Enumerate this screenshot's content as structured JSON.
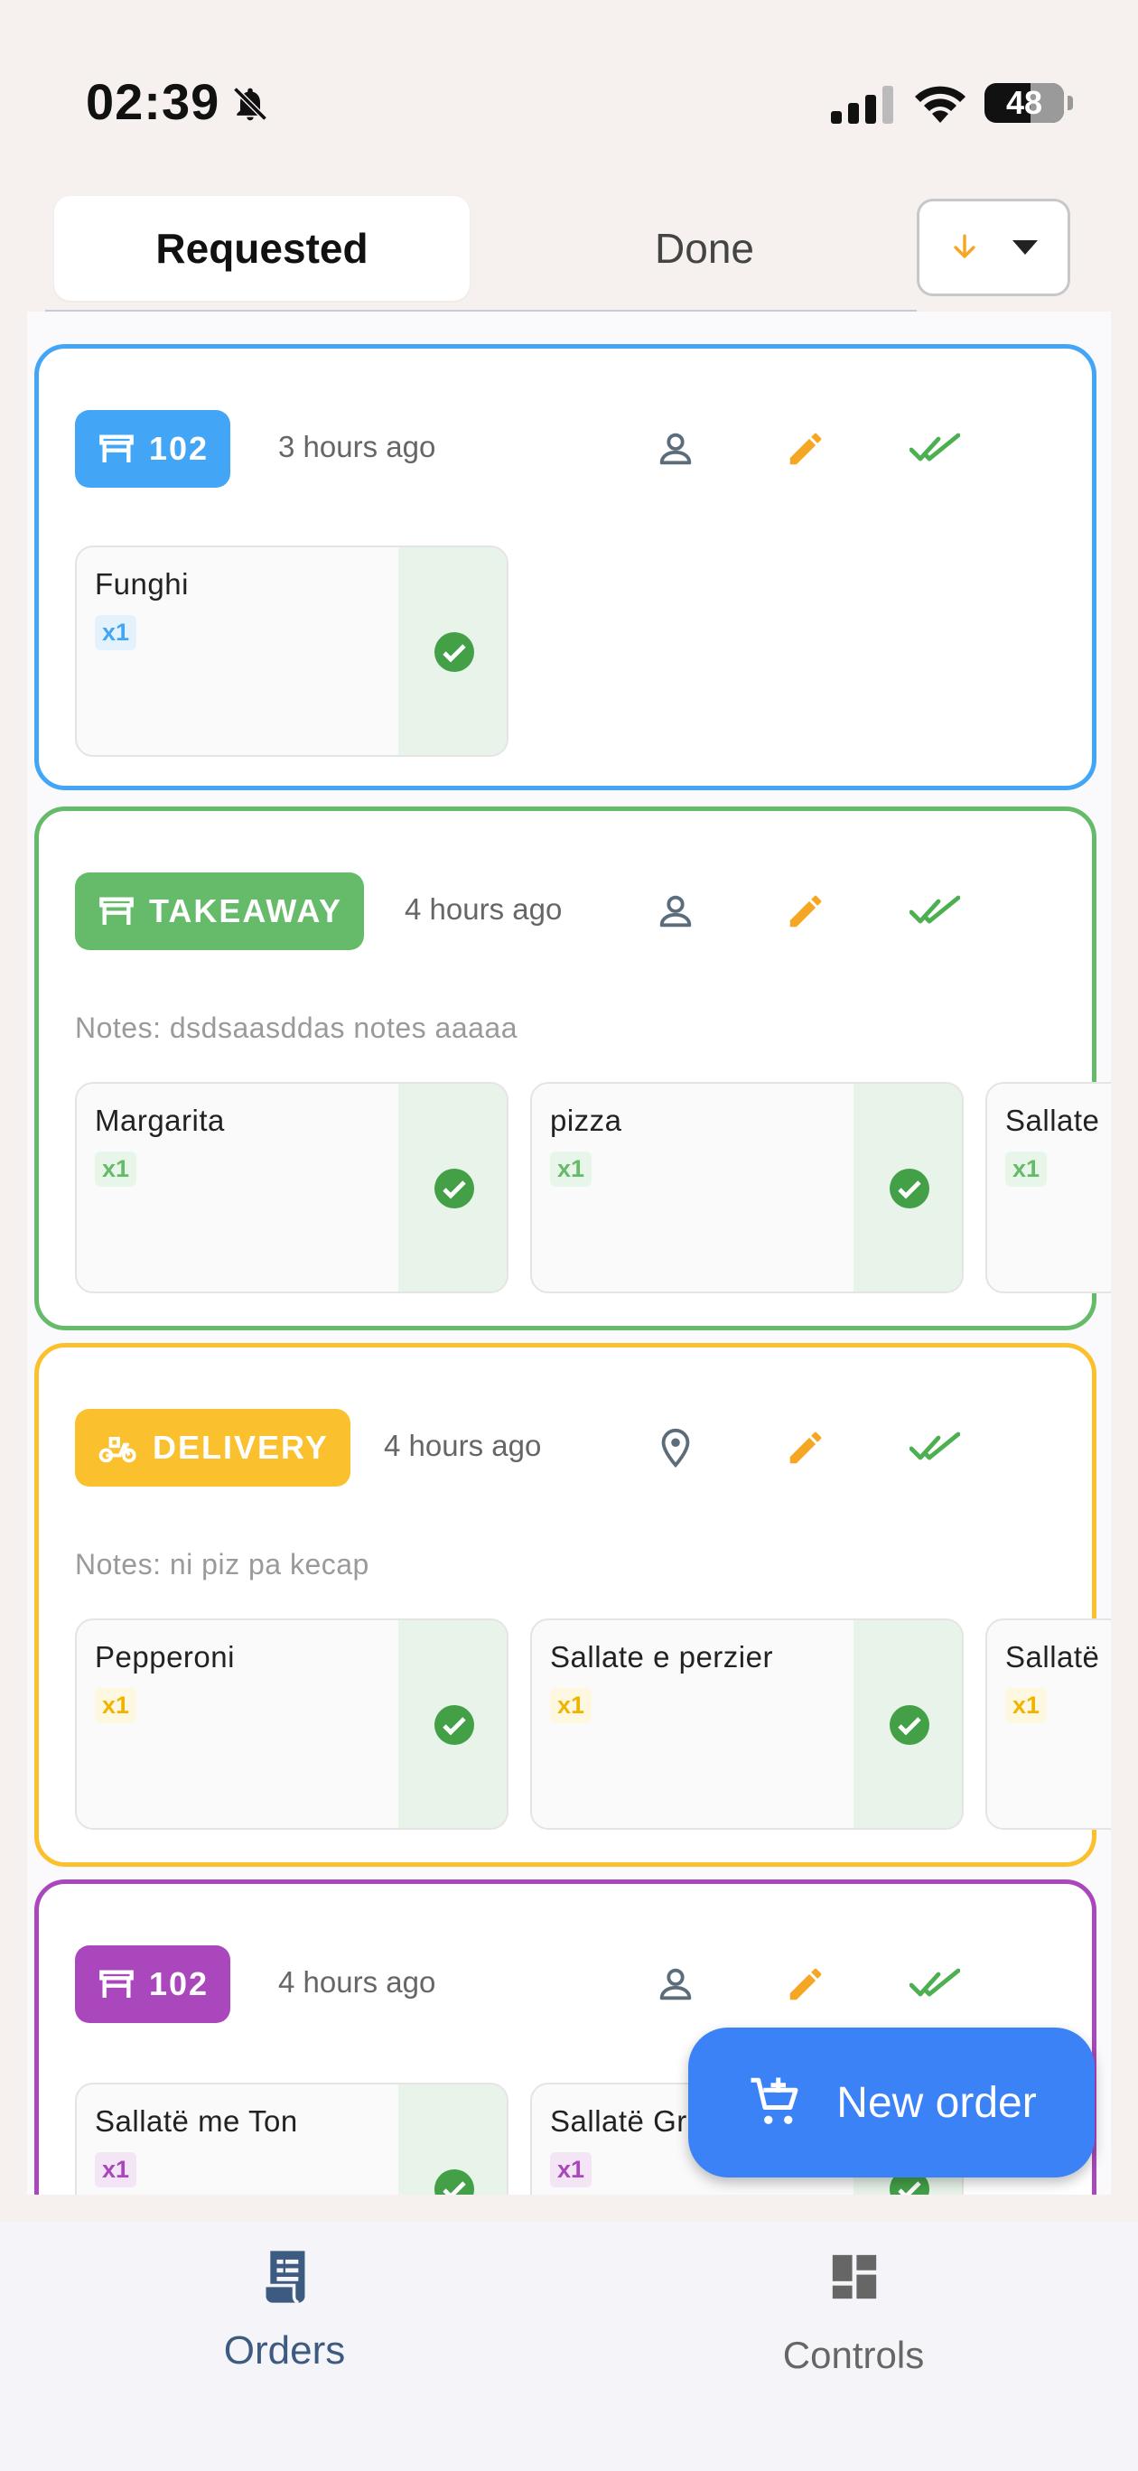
{
  "status_bar": {
    "time": "02:39",
    "battery": "48"
  },
  "tabs": {
    "requested": "Requested",
    "done": "Done"
  },
  "orders": [
    {
      "badge": "102",
      "type": "table",
      "color": "#42a5f5",
      "time": "3 hours ago",
      "person_icon": "person-icon",
      "items": [
        {
          "name": "Funghi",
          "qty": "x1"
        }
      ]
    },
    {
      "badge": "TAKEAWAY",
      "type": "takeaway",
      "color": "#66bb6a",
      "time": "4 hours ago",
      "person_icon": "person-icon",
      "notes": "Notes: dsdsaasddas notes aaaaa",
      "items": [
        {
          "name": "Margarita",
          "qty": "x1"
        },
        {
          "name": "pizza",
          "qty": "x1"
        },
        {
          "name": "Sallate",
          "qty": "x1"
        }
      ]
    },
    {
      "badge": "DELIVERY",
      "type": "delivery",
      "color": "#fbc02d",
      "time": "4 hours ago",
      "person_icon": "location-pin-icon",
      "notes": "Notes: ni piz pa kecap",
      "items": [
        {
          "name": "Pepperoni",
          "qty": "x1"
        },
        {
          "name": "Sallate e perzier",
          "qty": "x1"
        },
        {
          "name": "Sallatë",
          "qty": "x1"
        }
      ]
    },
    {
      "badge": "102",
      "type": "table",
      "color": "#ab47bc",
      "time": "4 hours ago",
      "person_icon": "person-icon",
      "items": [
        {
          "name": "Sallatë me Ton",
          "qty": "x1"
        },
        {
          "name": "Sallatë Gr",
          "qty": "x1"
        }
      ]
    }
  ],
  "fab": {
    "label": "New order"
  },
  "bottom_nav": {
    "orders": "Orders",
    "controls": "Controls"
  },
  "colors": {
    "edit": "#f5a623",
    "done": "#4caf50",
    "nav_active": "#3d5a80"
  }
}
